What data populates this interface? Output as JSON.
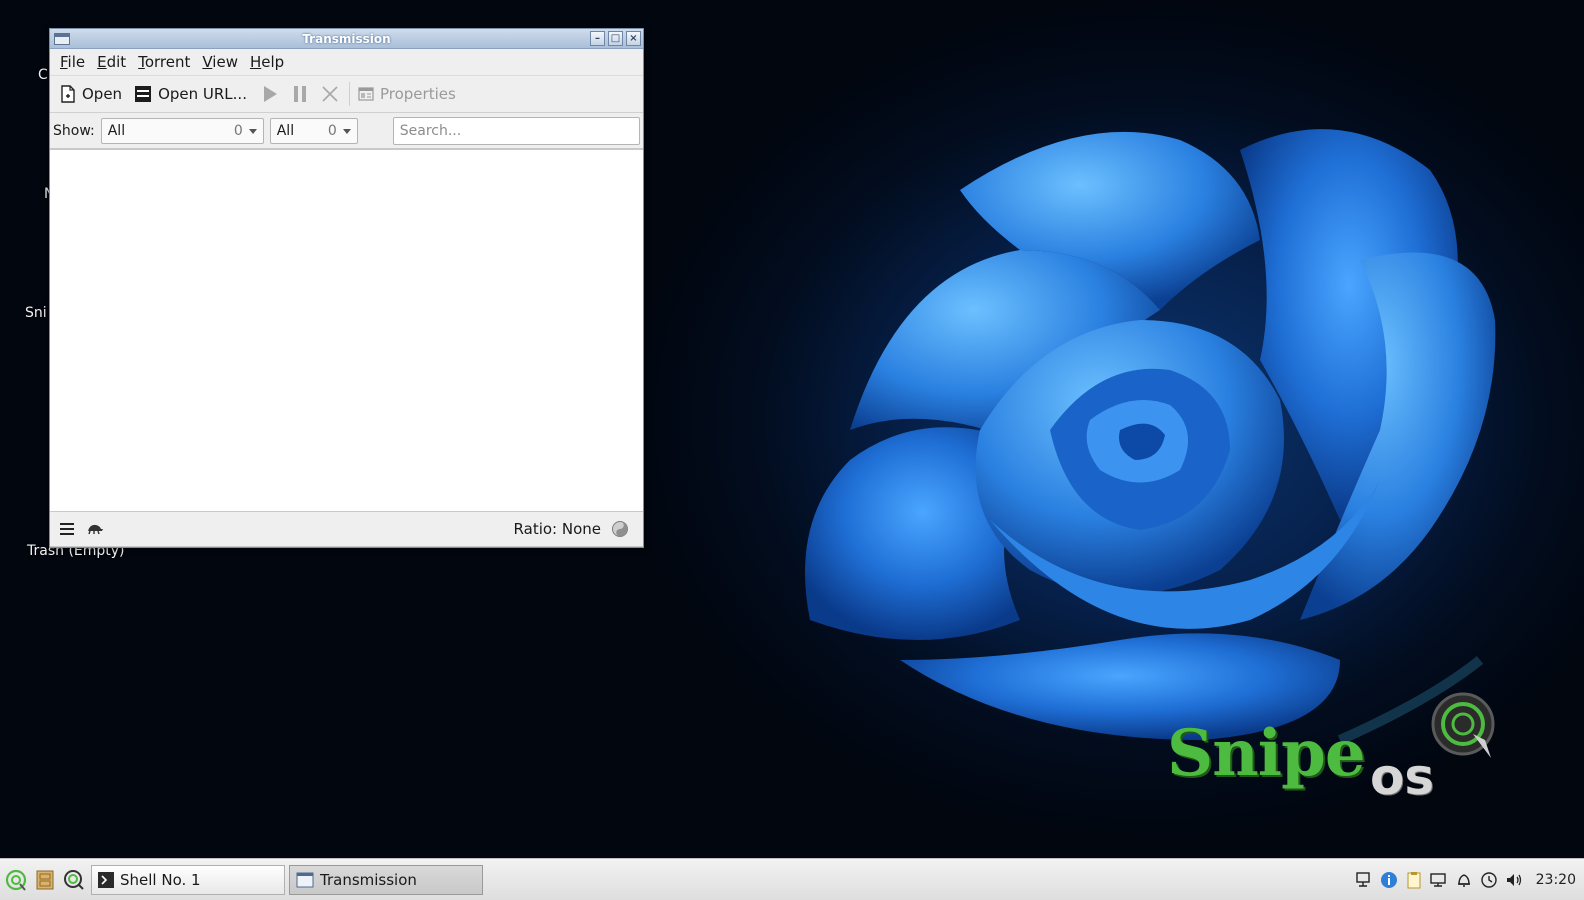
{
  "desktop": {
    "icon_labels": [
      "C",
      "N",
      "Sni",
      "Trash (Empty)"
    ],
    "logo": {
      "snipe": "Snipe",
      "os": "os"
    }
  },
  "window": {
    "title": "Transmission",
    "menu": [
      "File",
      "Edit",
      "Torrent",
      "View",
      "Help"
    ],
    "toolbar": {
      "open_label": "Open",
      "open_url_label": "Open URL...",
      "properties_label": "Properties"
    },
    "filter": {
      "show_label": "Show:",
      "activity": {
        "value": "All",
        "count": "0"
      },
      "tracker": {
        "value": "All",
        "count": "0"
      },
      "search_placeholder": "Search..."
    },
    "status": {
      "ratio": "Ratio: None"
    }
  },
  "taskbar": {
    "tasks": [
      {
        "label": "Shell No. 1",
        "icon": "terminal-icon"
      },
      {
        "label": "Transmission",
        "icon": "window-icon",
        "active": true
      }
    ],
    "clock": "23:20"
  },
  "colors": {
    "accent_green": "#4dbb3f",
    "titlebar": "#a9bfd9",
    "rose_blue": "#1e6fd6"
  }
}
